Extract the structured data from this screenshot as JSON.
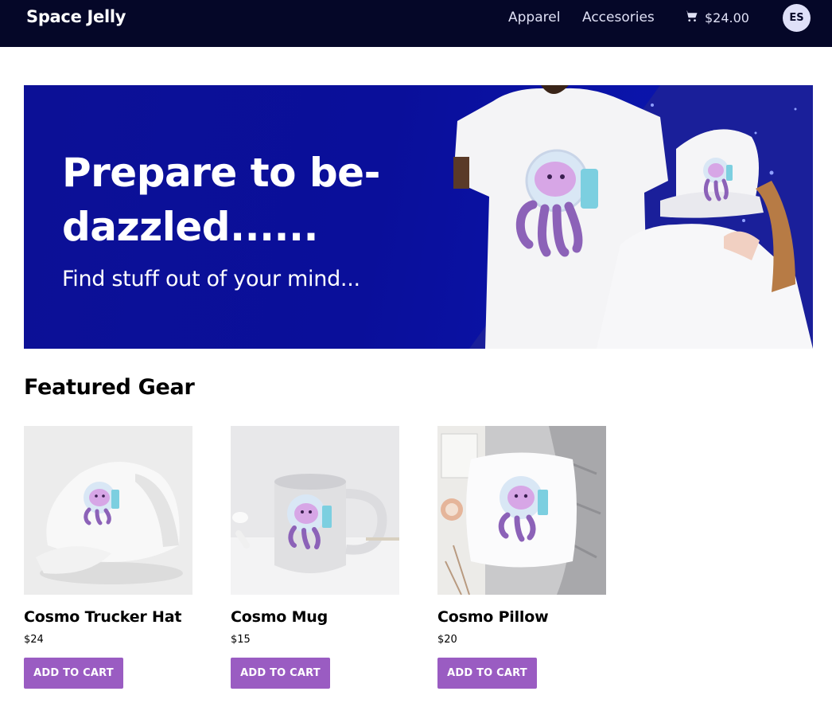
{
  "header": {
    "brand": "Space Jelly",
    "nav": [
      {
        "label": "Apparel"
      },
      {
        "label": "Accesories"
      }
    ],
    "cart_total": "$24.00",
    "avatar_initials": "ES",
    "cart_icon": "cart-icon"
  },
  "hero": {
    "title": "Prepare to be-dazzled......",
    "subtitle": "Find stuff out of your mind..."
  },
  "featured": {
    "title": "Featured Gear",
    "products": [
      {
        "name": "Cosmo Trucker Hat",
        "price": "$24",
        "button": "Add to Cart"
      },
      {
        "name": "Cosmo Mug",
        "price": "$15",
        "button": "Add to Cart"
      },
      {
        "name": "Cosmo Pillow",
        "price": "$20",
        "button": "Add to Cart"
      }
    ]
  },
  "colors": {
    "header_bg": "#050728",
    "hero_bg": "#0c1096",
    "button_bg": "#9a5cc2"
  }
}
